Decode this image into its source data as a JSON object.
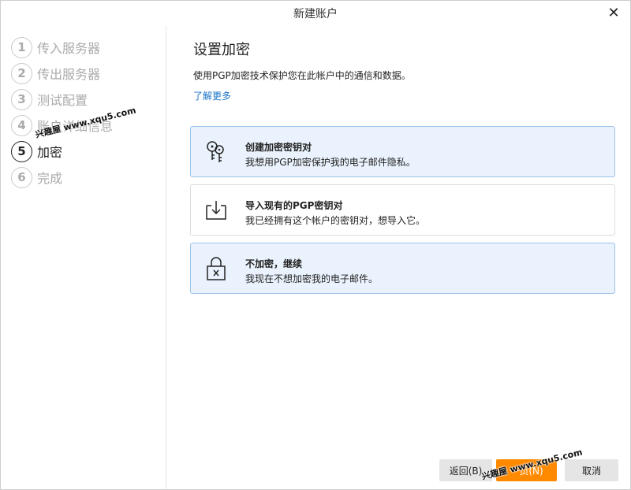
{
  "window": {
    "title": "新建账户"
  },
  "steps": [
    {
      "number": "1",
      "label": "传入服务器"
    },
    {
      "number": "2",
      "label": "传出服务器"
    },
    {
      "number": "3",
      "label": "测试配置"
    },
    {
      "number": "4",
      "label": "账户详细信息"
    },
    {
      "number": "5",
      "label": "加密"
    },
    {
      "number": "6",
      "label": "完成"
    }
  ],
  "active_step": "5",
  "main": {
    "heading": "设置加密",
    "description": "使用PGP加密技术保护您在此帐户中的通信和数据。",
    "learn_more": "了解更多",
    "options": [
      {
        "title": "创建加密密钥对",
        "subtitle": "我想用PGP加密保护我的电子邮件隐私。",
        "icon": "keys-icon",
        "selected": true
      },
      {
        "title": "导入现有的PGP密钥对",
        "subtitle": "我已经拥有这个帐户的密钥对，想导入它。",
        "icon": "import-icon",
        "selected": false
      },
      {
        "title": "不加密，继续",
        "subtitle": "我现在不想加密我的电子邮件。",
        "icon": "unlocked-icon",
        "selected": true
      }
    ]
  },
  "buttons": {
    "back": "返回(B)",
    "next": "一页(N)",
    "cancel": "取消"
  },
  "watermark": {
    "text": "兴趣屋 www.xqu5.com"
  },
  "colors": {
    "accent": "#ff8a00",
    "link": "#1a73c8",
    "selected_bg": "#eaf3fd",
    "selected_border": "#9cc3ea"
  }
}
